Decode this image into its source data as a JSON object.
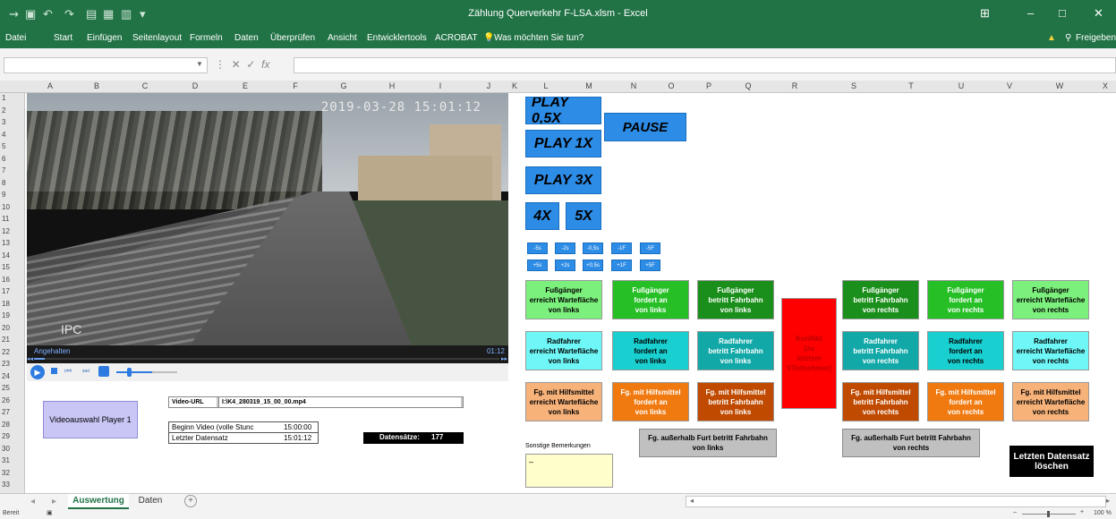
{
  "window": {
    "title": "Zählung Querverkehr F-LSA.xlsm - Excel",
    "share_label": "Freigeben",
    "warning_icon": "warning-icon",
    "minimize": "–",
    "restore": "□",
    "close": "✕"
  },
  "ribbon": {
    "tabs": [
      "Datei",
      "Start",
      "Einfügen",
      "Seitenlayout",
      "Formeln",
      "Daten",
      "Überprüfen",
      "Ansicht",
      "Entwicklertools",
      "ACROBAT"
    ],
    "tell_me": "Was möchten Sie tun?"
  },
  "formula_bar": {
    "fx_label": "fx"
  },
  "columns": [
    "A",
    "B",
    "C",
    "D",
    "E",
    "F",
    "G",
    "H",
    "I",
    "J",
    "K",
    "L",
    "M",
    "N",
    "O",
    "P",
    "Q",
    "R",
    "S",
    "T",
    "U",
    "V",
    "W",
    "X"
  ],
  "rows": [
    "1",
    "2",
    "3",
    "4",
    "5",
    "6",
    "7",
    "8",
    "9",
    "10",
    "11",
    "12",
    "13",
    "14",
    "15",
    "16",
    "17",
    "18",
    "19",
    "20",
    "21",
    "22",
    "23",
    "24",
    "25",
    "26",
    "27",
    "28",
    "29",
    "30",
    "31",
    "32",
    "33"
  ],
  "video": {
    "timestamp": "2019-03-28 15:01:12",
    "watermark": "IPC",
    "status": "Angehalten",
    "time": "01:12"
  },
  "playback": {
    "play05": "PLAY 0,5X",
    "play1": "PLAY 1X",
    "play3": "PLAY 3X",
    "x4": "4X",
    "x5": "5X",
    "pause": "PAUSE",
    "step_back": [
      "-5s",
      "-2s",
      "-0,5s",
      "-1F",
      "-5F"
    ],
    "step_fwd": [
      "+5s",
      "+2s",
      "+0.5s",
      "+1F",
      "+5F"
    ]
  },
  "info": {
    "video_url_label": "Video-URL",
    "video_url_value": "I:\\K4_280319_15_00_00.mp4",
    "video_select": "Videoauswahl Player 1",
    "start_label": "Beginn Video (volle Stunc",
    "start_value": "15:00:00",
    "last_label": "Letzter Datensatz",
    "last_value": "15:01:12",
    "count_label": "Datensätze:",
    "count_value": "177"
  },
  "categories": {
    "row1": [
      {
        "text": "Fußgänger\nerreicht Wartefläche\nvon links",
        "bg": "#7cf07c",
        "fg": "#000"
      },
      {
        "text": "Fußgänger\nfordert an\nvon links",
        "bg": "#26c026",
        "fg": "#fff"
      },
      {
        "text": "Fußgänger\nbetritt Fahrbahn\nvon links",
        "bg": "#1b8f1b",
        "fg": "#fff"
      },
      {
        "text": "Fußgänger\nbetritt Fahrbahn\nvon rechts",
        "bg": "#1b8f1b",
        "fg": "#fff"
      },
      {
        "text": "Fußgänger\nfordert an\nvon rechts",
        "bg": "#26c026",
        "fg": "#fff"
      },
      {
        "text": "Fußgänger\nerreicht Wartefläche\nvon rechts",
        "bg": "#7cf07c",
        "fg": "#000"
      }
    ],
    "row2": [
      {
        "text": "Radfahrer\nerreicht Wartefläche\nvon links",
        "bg": "#6ff7f7",
        "fg": "#000"
      },
      {
        "text": "Radfahrer\nfordert an\nvon links",
        "bg": "#19cfcf",
        "fg": "#000"
      },
      {
        "text": "Radfahrer\nbetritt Fahrbahn\nvon links",
        "bg": "#12a8a8",
        "fg": "#fff"
      },
      {
        "text": "Radfahrer\nbetritt Fahrbahn\nvon rechts",
        "bg": "#12a8a8",
        "fg": "#fff"
      },
      {
        "text": "Radfahrer\nfordert an\nvon rechts",
        "bg": "#19cfcf",
        "fg": "#000"
      },
      {
        "text": "Radfahrer\nerreicht Wartefläche\nvon rechts",
        "bg": "#6ff7f7",
        "fg": "#000"
      }
    ],
    "row3": [
      {
        "text": "Fg. mit Hilfsmittel\nerreicht Wartefläche\nvon links",
        "bg": "#f7b27a",
        "fg": "#000"
      },
      {
        "text": "Fg. mit Hilfsmittel\nfordert an\nvon links",
        "bg": "#f07a10",
        "fg": "#fff"
      },
      {
        "text": "Fg. mit Hilfsmittel\nbetritt Fahrbahn\nvon links",
        "bg": "#c04a00",
        "fg": "#fff"
      },
      {
        "text": "Fg. mit Hilfsmittel\nbetritt Fahrbahn\nvon rechts",
        "bg": "#c04a00",
        "fg": "#fff"
      },
      {
        "text": "Fg. mit Hilfsmittel\nfordert an\nvon rechts",
        "bg": "#f07a10",
        "fg": "#fff"
      },
      {
        "text": "Fg. mit Hilfsmittel\nerreicht Wartefläche\nvon rechts",
        "bg": "#f7b27a",
        "fg": "#000"
      }
    ],
    "conflict": "Konflikt\n(zu\nletztem\nVTeilnehmer)",
    "outside_left": "Fg. außerhalb Furt betritt Fahrbahn\nvon links",
    "outside_right": "Fg. außerhalb Furt betritt Fahrbahn\nvon rechts",
    "remarks_label": "Sonstige Bemerkungen",
    "remarks_value": "–",
    "delete_last": "Letzten Datensatz\nlöschen"
  },
  "sheets": {
    "tabs": [
      "Auswertung",
      "Daten"
    ],
    "active": "Auswertung",
    "add": "+"
  },
  "status": {
    "ready": "Bereit",
    "zoom": "100 %"
  }
}
